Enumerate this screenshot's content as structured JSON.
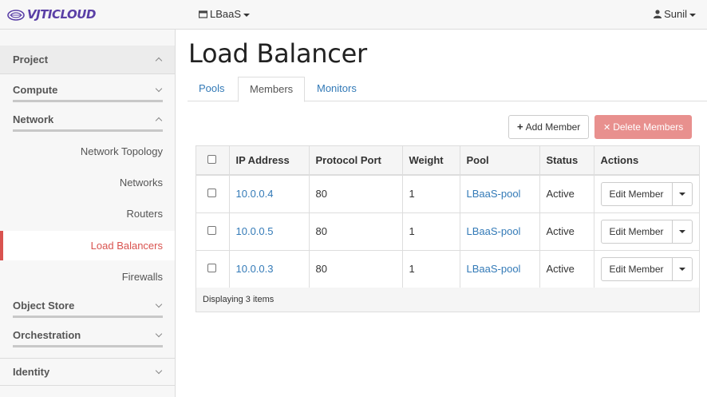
{
  "brand": {
    "name": "VJTICLOUD"
  },
  "header": {
    "project": "LBaaS",
    "user": "Sunil"
  },
  "sidebar": {
    "sections": [
      {
        "label": "Project"
      },
      {
        "label": "Compute"
      },
      {
        "label": "Network"
      },
      {
        "label": "Object Store"
      },
      {
        "label": "Orchestration"
      },
      {
        "label": "Identity"
      }
    ],
    "network_items": [
      {
        "label": "Network Topology"
      },
      {
        "label": "Networks"
      },
      {
        "label": "Routers"
      },
      {
        "label": "Load Balancers"
      },
      {
        "label": "Firewalls"
      }
    ]
  },
  "main": {
    "title": "Load Balancer",
    "tabs": [
      {
        "label": "Pools"
      },
      {
        "label": "Members"
      },
      {
        "label": "Monitors"
      }
    ],
    "add_label": "Add Member",
    "delete_label": "Delete Members",
    "table": {
      "columns": [
        "IP Address",
        "Protocol Port",
        "Weight",
        "Pool",
        "Status",
        "Actions"
      ],
      "rows": [
        {
          "ip": "10.0.0.4",
          "port": "80",
          "weight": "1",
          "pool": "LBaaS-pool",
          "status": "Active",
          "action": "Edit Member"
        },
        {
          "ip": "10.0.0.5",
          "port": "80",
          "weight": "1",
          "pool": "LBaaS-pool",
          "status": "Active",
          "action": "Edit Member"
        },
        {
          "ip": "10.0.0.3",
          "port": "80",
          "weight": "1",
          "pool": "LBaaS-pool",
          "status": "Active",
          "action": "Edit Member"
        }
      ],
      "footer": "Displaying 3 items"
    }
  },
  "colors": {
    "accent": "#d9534f",
    "link": "#337ab7",
    "brand": "#5a3fa6"
  }
}
